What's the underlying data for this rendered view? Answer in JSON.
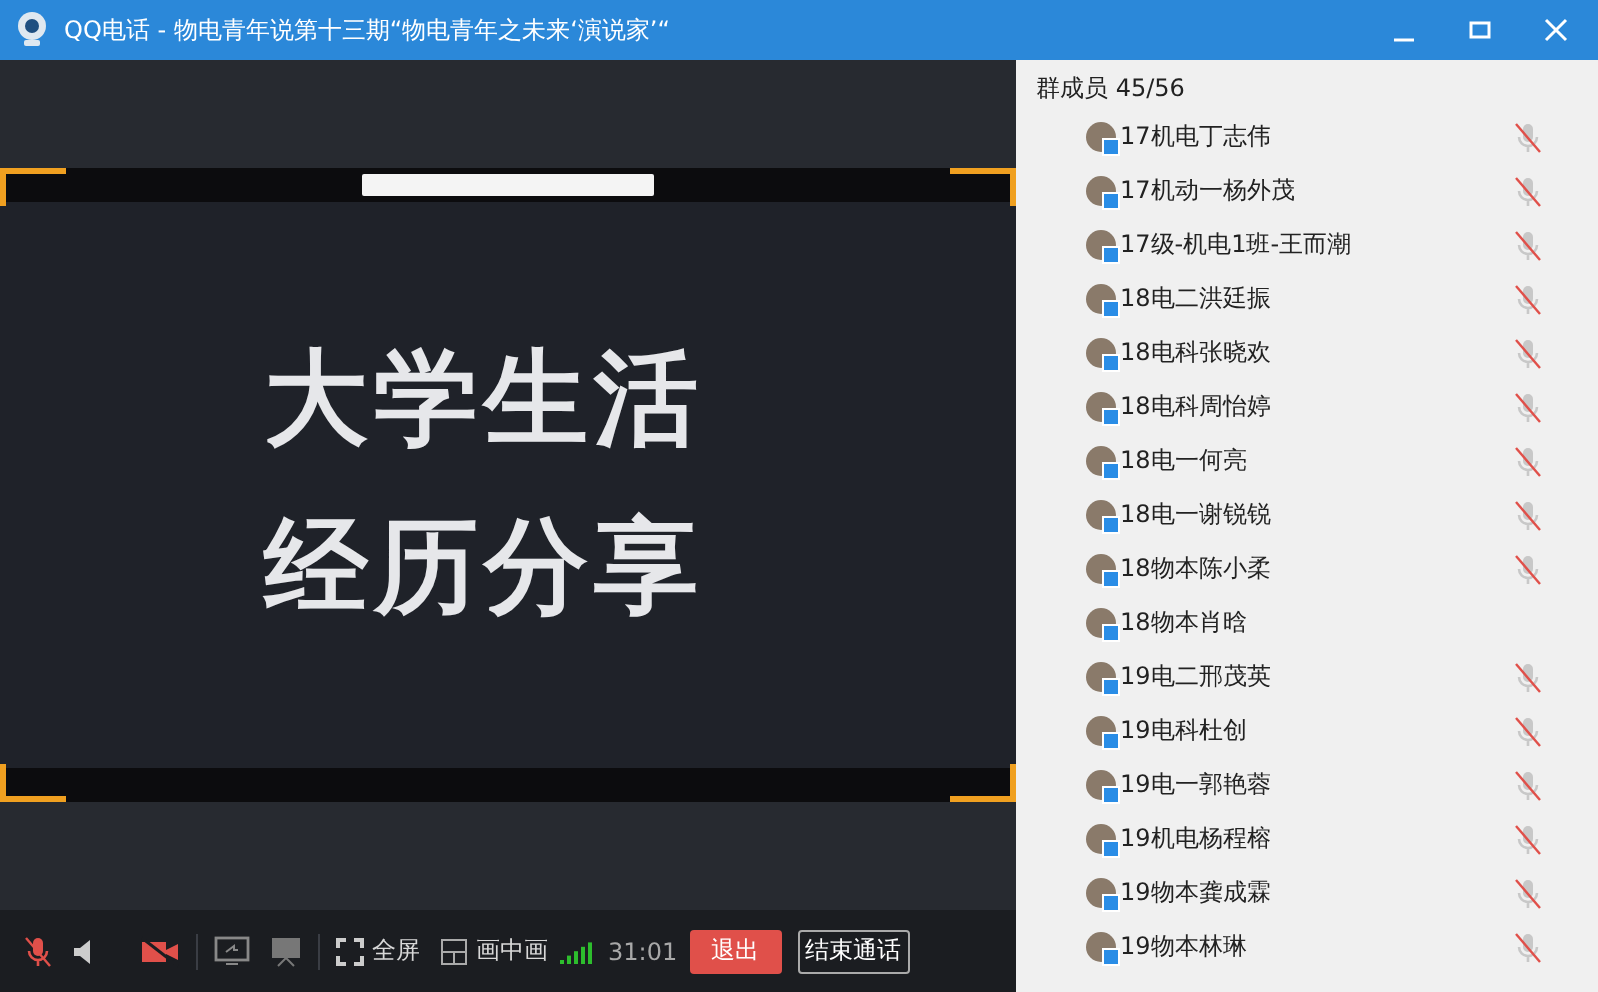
{
  "window": {
    "title": "QQ电话 - 物电青年说第十三期“物电青年之未来‘演说家’“"
  },
  "slide": {
    "lines": [
      "大学生活",
      "经历分享"
    ]
  },
  "toolbar": {
    "mic_muted": true,
    "camera_off": true,
    "fullscreen": "全屏",
    "pip": "画中画",
    "duration": "31:01",
    "exit": "退出",
    "end_call": "结束通话"
  },
  "members": {
    "header": "群成员 45/56",
    "items": [
      {
        "name": "17机电丁志伟",
        "muted": true
      },
      {
        "name": "17机动一杨外茂",
        "muted": true
      },
      {
        "name": "17级-机电1班-王而潮",
        "muted": true
      },
      {
        "name": "18电二洪廷振",
        "muted": true
      },
      {
        "name": "18电科张晓欢",
        "muted": true
      },
      {
        "name": "18电科周怡婷",
        "muted": true
      },
      {
        "name": "18电一何亮",
        "muted": true
      },
      {
        "name": "18电一谢锐锐",
        "muted": true
      },
      {
        "name": "18物本陈小柔",
        "muted": true
      },
      {
        "name": "18物本肖晗",
        "muted": false
      },
      {
        "name": "19电二邢茂英",
        "muted": true
      },
      {
        "name": "19电科杜创",
        "muted": true
      },
      {
        "name": "19电一郭艳蓉",
        "muted": true
      },
      {
        "name": "19机电杨程榕",
        "muted": true
      },
      {
        "name": "19物本龚成霖",
        "muted": true
      },
      {
        "name": "19物本林琳",
        "muted": true
      }
    ]
  }
}
